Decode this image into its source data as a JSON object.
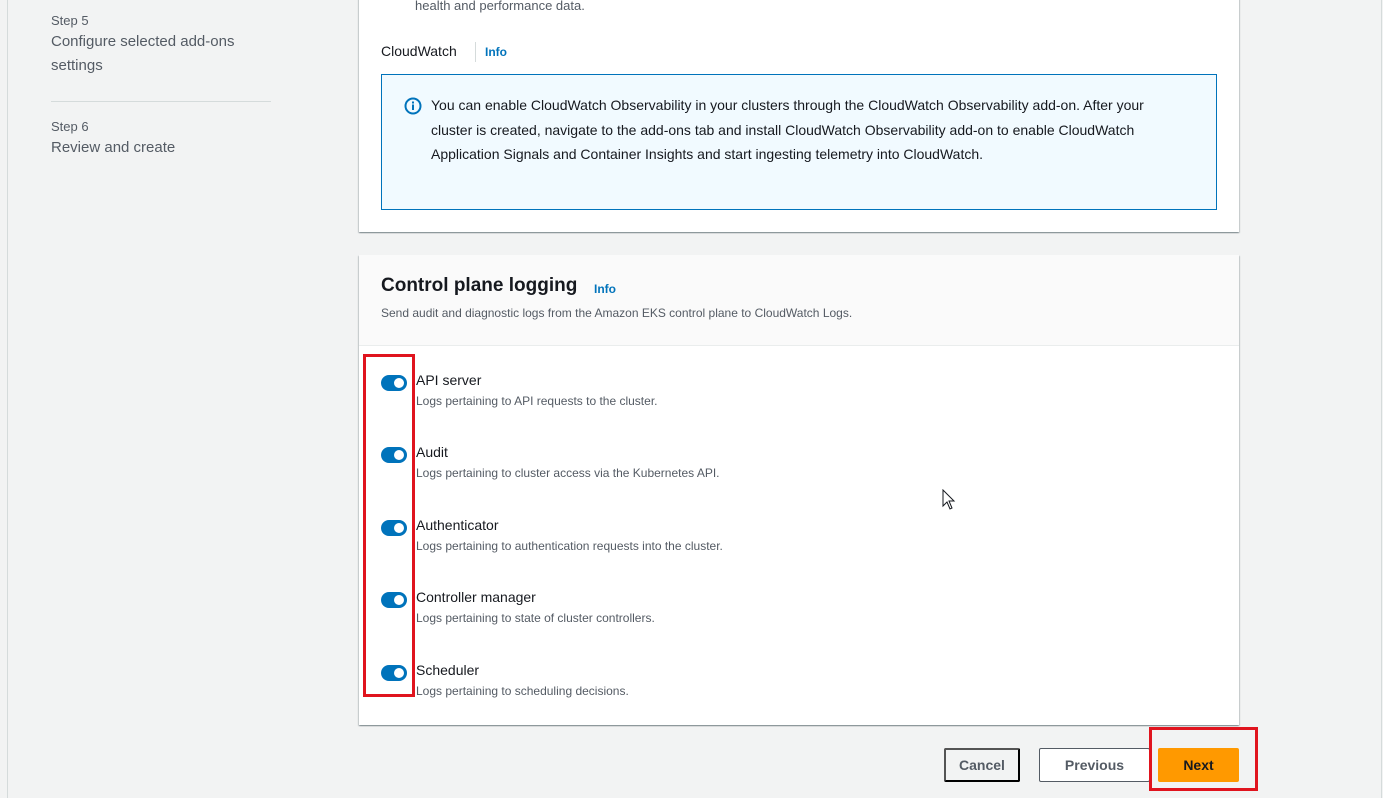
{
  "sidebar": {
    "steps": [
      {
        "num": "Step 5",
        "title": "Configure selected add-ons settings"
      },
      {
        "num": "Step 6",
        "title": "Review and create"
      }
    ]
  },
  "observability": {
    "cut_text": "health and performance data.",
    "cloudwatch_label": "CloudWatch",
    "info_label": "Info",
    "alert_text": "You can enable CloudWatch Observability in your clusters through the CloudWatch Observability add-on. After your cluster is created, navigate to the add-ons tab and install CloudWatch Observability add-on to enable CloudWatch Application Signals and Container Insights and start ingesting telemetry into CloudWatch.",
    "alert_icon": "info-circle-icon"
  },
  "logging": {
    "title": "Control plane logging",
    "info_label": "Info",
    "description": "Send audit and diagnostic logs from the Amazon EKS control plane to CloudWatch Logs.",
    "items": [
      {
        "label": "API server",
        "description": "Logs pertaining to API requests to the cluster.",
        "enabled": true
      },
      {
        "label": "Audit",
        "description": "Logs pertaining to cluster access via the Kubernetes API.",
        "enabled": true
      },
      {
        "label": "Authenticator",
        "description": "Logs pertaining to authentication requests into the cluster.",
        "enabled": true
      },
      {
        "label": "Controller manager",
        "description": "Logs pertaining to state of cluster controllers.",
        "enabled": true
      },
      {
        "label": "Scheduler",
        "description": "Logs pertaining to scheduling decisions.",
        "enabled": true
      }
    ]
  },
  "footer": {
    "cancel": "Cancel",
    "previous": "Previous",
    "next": "Next"
  },
  "colors": {
    "accent": "#0073bb",
    "primary_button": "#ff9900",
    "highlight": "#e0141e"
  }
}
